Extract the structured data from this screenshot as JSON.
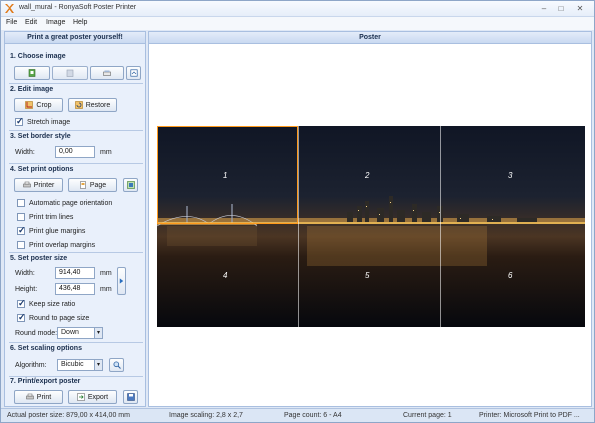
{
  "window": {
    "title": "wall_mural - RonyaSoft Poster Printer",
    "menu": [
      "File",
      "Edit",
      "Image",
      "Help"
    ]
  },
  "left": {
    "header": "Print a great poster yourself!",
    "sections": {
      "choose_image": "1. Choose image",
      "edit_image": "2. Edit image",
      "border_style": "3. Set border style",
      "print_options": "4. Set print options",
      "poster_size": "5. Set poster size",
      "scaling": "6. Set scaling options",
      "print_export": "7. Print/export poster"
    },
    "edit_buttons": {
      "crop": "Crop",
      "restore": "Restore"
    },
    "stretch_image": "Stretch image",
    "border": {
      "width_label": "Width:",
      "width_value": "0,00",
      "unit": "mm"
    },
    "print_buttons": {
      "printer": "Printer",
      "page": "Page"
    },
    "print_checks": [
      {
        "label": "Automatic page orientation",
        "checked": false
      },
      {
        "label": "Print trim lines",
        "checked": false
      },
      {
        "label": "Print glue margins",
        "checked": true
      },
      {
        "label": "Print overlap margins",
        "checked": false
      }
    ],
    "size": {
      "width_label": "Width:",
      "width_value": "914,40",
      "height_label": "Height:",
      "height_value": "436,48",
      "unit": "mm",
      "keep_ratio": "Keep size ratio",
      "round_to_page": "Round to page size",
      "round_mode_label": "Round mode:",
      "round_mode_value": "Down"
    },
    "scaling": {
      "algorithm_label": "Algorithm:",
      "algorithm_value": "Bicubic"
    },
    "output_buttons": {
      "print": "Print",
      "export": "Export"
    }
  },
  "right": {
    "header": "Poster",
    "pages": [
      "1",
      "2",
      "3",
      "4",
      "5",
      "6"
    ]
  },
  "status": {
    "poster_size": "Actual poster size: 879,00 x 414,00 mm",
    "image_scaling": "Image scaling: 2,8 x 2,7",
    "page_count": "Page count: 6 - A4",
    "current_page": "Current page: 1",
    "printer": "Printer: Microsoft Print to PDF ..."
  },
  "colors": {
    "accent": "#ff9a1c",
    "panel_bg": "#e9f0fb",
    "header_bg": "#c9d9f1"
  }
}
